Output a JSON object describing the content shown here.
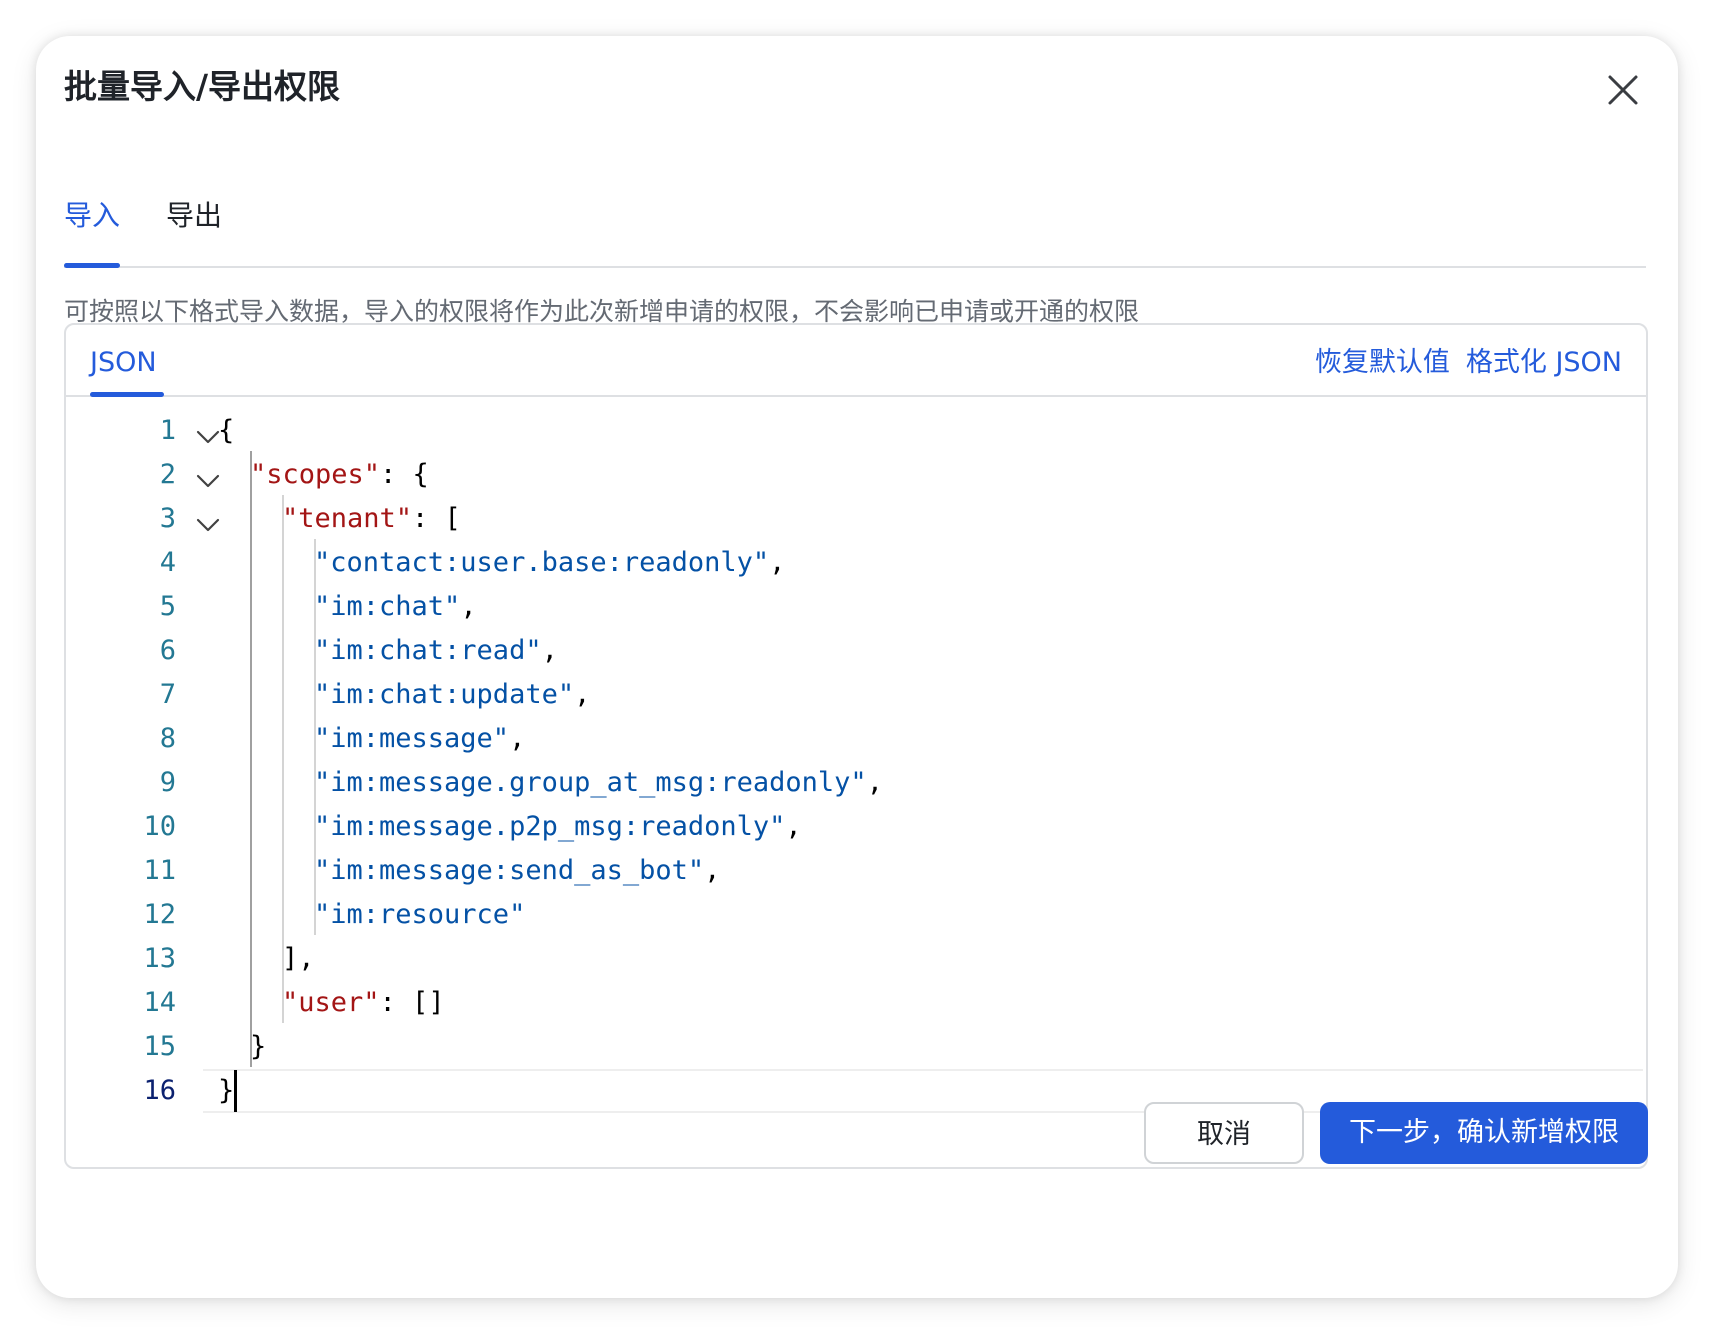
{
  "dialog": {
    "title": "批量导入/导出权限",
    "close_icon": "close-icon"
  },
  "tabs": [
    {
      "label": "导入",
      "active": true
    },
    {
      "label": "导出",
      "active": false
    }
  ],
  "description": "可按照以下格式导入数据，导入的权限将作为此次新增申请的权限，不会影响已申请或开通的权限",
  "editor": {
    "tab_label": "JSON",
    "restore_default_label": "恢复默认值",
    "format_json_label": "格式化 JSON",
    "cursor_line": 16,
    "lines": [
      {
        "n": "1",
        "foldable": true,
        "parts": [
          {
            "t": "{",
            "c": "p"
          }
        ]
      },
      {
        "n": "2",
        "foldable": true,
        "parts": [
          {
            "t": "\"scopes\"",
            "c": "k"
          },
          {
            "t": ": {",
            "c": "p"
          }
        ]
      },
      {
        "n": "3",
        "foldable": true,
        "parts": [
          {
            "t": "\"tenant\"",
            "c": "k"
          },
          {
            "t": ": [",
            "c": "p"
          }
        ]
      },
      {
        "n": "4",
        "foldable": false,
        "parts": [
          {
            "t": "\"contact:user.base:readonly\"",
            "c": "s"
          },
          {
            "t": ",",
            "c": "p"
          }
        ]
      },
      {
        "n": "5",
        "foldable": false,
        "parts": [
          {
            "t": "\"im:chat\"",
            "c": "s"
          },
          {
            "t": ",",
            "c": "p"
          }
        ]
      },
      {
        "n": "6",
        "foldable": false,
        "parts": [
          {
            "t": "\"im:chat:read\"",
            "c": "s"
          },
          {
            "t": ",",
            "c": "p"
          }
        ]
      },
      {
        "n": "7",
        "foldable": false,
        "parts": [
          {
            "t": "\"im:chat:update\"",
            "c": "s"
          },
          {
            "t": ",",
            "c": "p"
          }
        ]
      },
      {
        "n": "8",
        "foldable": false,
        "parts": [
          {
            "t": "\"im:message\"",
            "c": "s"
          },
          {
            "t": ",",
            "c": "p"
          }
        ]
      },
      {
        "n": "9",
        "foldable": false,
        "parts": [
          {
            "t": "\"im:message.group_at_msg:readonly\"",
            "c": "s"
          },
          {
            "t": ",",
            "c": "p"
          }
        ]
      },
      {
        "n": "10",
        "foldable": false,
        "parts": [
          {
            "t": "\"im:message.p2p_msg:readonly\"",
            "c": "s"
          },
          {
            "t": ",",
            "c": "p"
          }
        ]
      },
      {
        "n": "11",
        "foldable": false,
        "parts": [
          {
            "t": "\"im:message:send_as_bot\"",
            "c": "s"
          },
          {
            "t": ",",
            "c": "p"
          }
        ]
      },
      {
        "n": "12",
        "foldable": false,
        "parts": [
          {
            "t": "\"im:resource\"",
            "c": "s"
          }
        ]
      },
      {
        "n": "13",
        "foldable": false,
        "parts": [
          {
            "t": "],",
            "c": "p"
          }
        ]
      },
      {
        "n": "14",
        "foldable": false,
        "parts": [
          {
            "t": "\"user\"",
            "c": "k"
          },
          {
            "t": ": []",
            "c": "p"
          }
        ]
      },
      {
        "n": "15",
        "foldable": false,
        "parts": [
          {
            "t": "}",
            "c": "p"
          }
        ]
      },
      {
        "n": "16",
        "foldable": false,
        "parts": [
          {
            "t": "}",
            "c": "p"
          }
        ]
      }
    ]
  },
  "footer": {
    "cancel_label": "取消",
    "confirm_label": "下一步，确认新增权限"
  },
  "colors": {
    "accent": "#245bdb",
    "json_key": "#a31515",
    "json_string": "#0451a5",
    "line_number": "#237893"
  }
}
